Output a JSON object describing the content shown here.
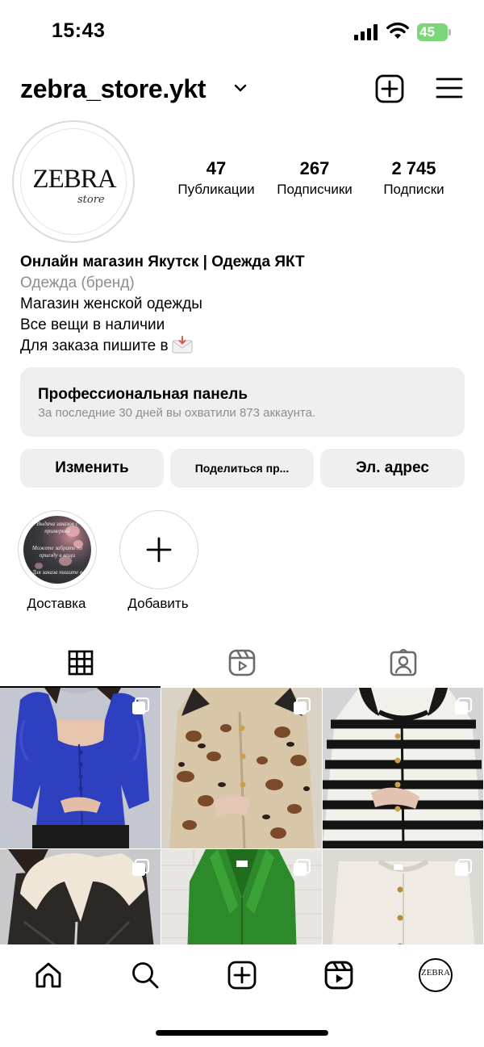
{
  "status_bar": {
    "time": "15:43",
    "battery_level": "45"
  },
  "header": {
    "username": "zebra_store.ykt"
  },
  "avatar": {
    "logo_main": "ZEBRA",
    "logo_sub": "store"
  },
  "stats": [
    {
      "value": "47",
      "label": "Публикации"
    },
    {
      "value": "267",
      "label": "Подписчики"
    },
    {
      "value": "2 745",
      "label": "Подписки"
    }
  ],
  "bio": {
    "name": "Онлайн магазин Якутск | Одежда ЯКТ",
    "category": "Одежда (бренд)",
    "line1": "Магазин женской одежды",
    "line2": "Все вещи в наличии",
    "line3": "Для заказа пишите в"
  },
  "professional_panel": {
    "title": "Профессиональная панель",
    "subtitle": "За последние 30 дней вы охватили 873 аккаунта."
  },
  "buttons": {
    "edit": "Изменить",
    "share": "Поделиться пр...",
    "email": "Эл. адрес"
  },
  "highlights": [
    {
      "label": "Доставка",
      "cover_text_top": "Выдача заказов с примеркой",
      "cover_text_mid": "Можете забрать по приезду в вещи",
      "cover_text_bottom": "Для заказа пишите в"
    },
    {
      "label": "Добавить"
    }
  ],
  "tabs": [
    "grid-icon",
    "reels-icon",
    "tagged-icon"
  ],
  "bottom_nav": {
    "avatar_text": "ZEBRA"
  },
  "colors": {
    "button_bg": "#efefef",
    "secondary_text": "#8e8e8e",
    "border": "#dbdbdb",
    "battery": "#7ed67a"
  }
}
